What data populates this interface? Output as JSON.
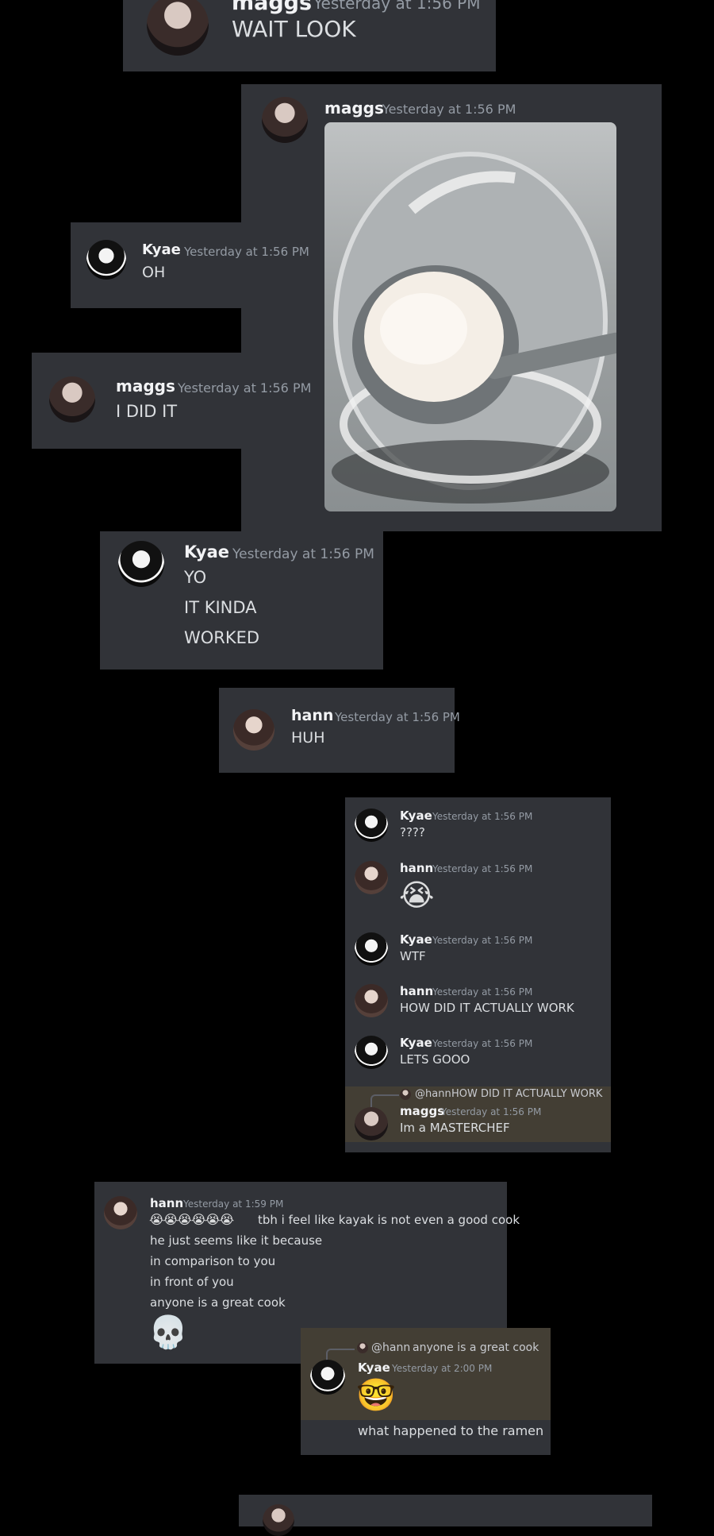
{
  "messages": {
    "m1": {
      "username": "maggs",
      "timestamp": "Yesterday at 1:56 PM",
      "text": "WAIT LOOK"
    },
    "m2": {
      "username": "maggs",
      "timestamp": "Yesterday at 1:56 PM"
    },
    "m3": {
      "username": "Kyae",
      "timestamp": "Yesterday at 1:56 PM",
      "text": "OH"
    },
    "m4": {
      "username": "maggs",
      "timestamp": "Yesterday at 1:56 PM",
      "text": "I DID IT"
    },
    "m5": {
      "username": "Kyae",
      "timestamp": "Yesterday at 1:56 PM",
      "lines": [
        "YO",
        "IT KINDA",
        "WORKED"
      ]
    },
    "m6": {
      "username": "hann",
      "timestamp": "Yesterday at 1:56 PM",
      "text": "HUH"
    }
  },
  "thread": [
    {
      "username": "Kyae",
      "timestamp": "Yesterday at 1:56 PM",
      "text": "????"
    },
    {
      "username": "hann",
      "timestamp": "Yesterday at 1:56 PM",
      "emoji": "😭"
    },
    {
      "username": "Kyae",
      "timestamp": "Yesterday at 1:56 PM",
      "text": "WTF"
    },
    {
      "username": "hann",
      "timestamp": "Yesterday at 1:56 PM",
      "text": "HOW DID IT ACTUALLY WORK"
    },
    {
      "username": "Kyae",
      "timestamp": "Yesterday at 1:56 PM",
      "text": "LETS GOOO"
    },
    {
      "username": "maggs",
      "timestamp": "Yesterday at 1:56 PM",
      "text": "Im a MASTERCHEF",
      "reply_to": {
        "mention": "@hann",
        "text": "HOW DID IT ACTUALLY WORK"
      }
    }
  ],
  "hann_long": {
    "username": "hann",
    "timestamp": "Yesterday at 1:59 PM",
    "first_line_emojis": "😭😭😭😭😭😭",
    "first_line_text": "tbh i feel like kayak is not even a good cook",
    "lines": [
      "he just seems like it because",
      "in comparison to you",
      "in front of you",
      "anyone is a great cook"
    ],
    "big_emoji": "💀"
  },
  "kyae_reply": {
    "username": "Kyae",
    "timestamp": "Yesterday at 2:00 PM",
    "reply_to": {
      "mention": "@hann",
      "text": "anyone is a great cook"
    },
    "emoji": "🤓",
    "text": "what happened to the ramen"
  },
  "colors": {
    "background": "#000000",
    "card": "#313338",
    "highlight": "#433e34",
    "name": "#f2f3f5",
    "timestamp": "#949ba4"
  }
}
